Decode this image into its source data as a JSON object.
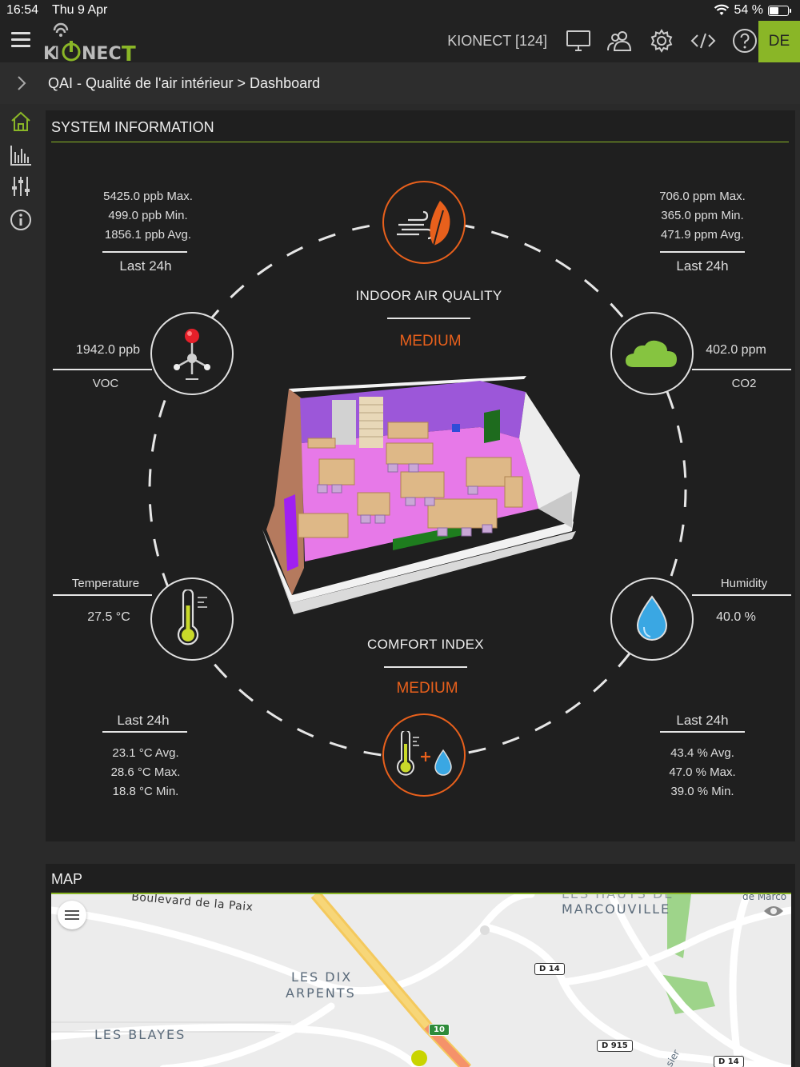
{
  "statusbar": {
    "time": "16:54",
    "date": "Thu 9 Apr",
    "battery": "54 %",
    "battery_level": 0.54
  },
  "header": {
    "logo_text": "KIONECT",
    "site_label": "KIONECT [124]",
    "language": "DE",
    "icons": [
      "monitor-icon",
      "users-icon",
      "gear-icon",
      "code-icon",
      "help-icon"
    ]
  },
  "breadcrumb": "QAI - Qualité de l'air intérieur > Dashboard",
  "sidenav": [
    "home-icon",
    "chart-icon",
    "sliders-icon",
    "info-icon"
  ],
  "system_info": {
    "title": "SYSTEM INFORMATION",
    "voc_stats": {
      "max": "5425.0 ppb Max.",
      "min": "499.0 ppb Min.",
      "avg": "1856.1 ppb Avg.",
      "period": "Last 24h"
    },
    "co2_stats": {
      "max": "706.0 ppm Max.",
      "min": "365.0 ppm Min.",
      "avg": "471.9 ppm Avg.",
      "period": "Last 24h"
    },
    "voc": {
      "value": "1942.0 ppb",
      "label": "VOC"
    },
    "co2": {
      "value": "402.0 ppm",
      "label": "CO2"
    },
    "iaq": {
      "title": "INDOOR AIR QUALITY",
      "status": "MEDIUM"
    },
    "temperature": {
      "label": "Temperature",
      "value": "27.5 °C"
    },
    "humidity": {
      "label": "Humidity",
      "value": "40.0 %"
    },
    "comfort": {
      "title": "COMFORT INDEX",
      "status": "MEDIUM"
    },
    "temp_stats": {
      "period": "Last 24h",
      "avg": "23.1 °C Avg.",
      "max": "28.6 °C Max.",
      "min": "18.8 °C Min."
    },
    "hum_stats": {
      "period": "Last 24h",
      "avg": "43.4 % Avg.",
      "max": "47.0 % Max.",
      "min": "39.0 % Min."
    },
    "accent_color": "#e8601c",
    "brand_color": "#8ab627"
  },
  "map": {
    "title": "MAP",
    "labels": {
      "boulevard": "Boulevard de la Paix",
      "dix_arpents_1": "LES DIX",
      "dix_arpents_2": "ARPENTS",
      "blayes": "LES BLAYES",
      "marcouville": "MARCOUVILLE",
      "marcouville_top": "LES HAUTS DE",
      "de_marco": "de Marco",
      "sier": "sier"
    },
    "roads": [
      "D 14",
      "D 915",
      "D 14",
      "10"
    ]
  }
}
